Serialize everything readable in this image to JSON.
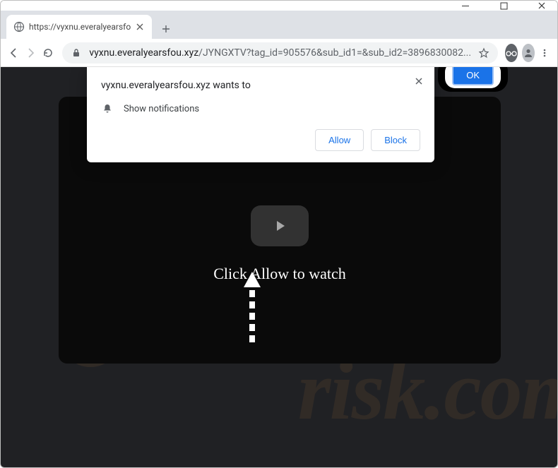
{
  "window": {
    "title": "https://vyxnu.everalyearsfou.xyz/"
  },
  "tab": {
    "title": "https://vyxnu.everalyearsfou.xyz/"
  },
  "omnibox": {
    "origin": "vyxnu.everalyearsfou.xyz",
    "path": "/JYNGXTV?tag_id=905576&sub_id1=&sub_id2=3896830082..."
  },
  "prompt": {
    "origin_text": "vyxnu.everalyearsfou.xyz wants to",
    "permission_label": "Show notifications",
    "allow_label": "Allow",
    "block_label": "Block"
  },
  "page": {
    "cta_text": "Click Allow to watch",
    "ok_label": "OK"
  },
  "watermark": {
    "text": "risk.com"
  },
  "colors": {
    "primary_blue": "#1a73e8",
    "dark_bg": "#202124",
    "player_bg": "#0a0a0a"
  }
}
